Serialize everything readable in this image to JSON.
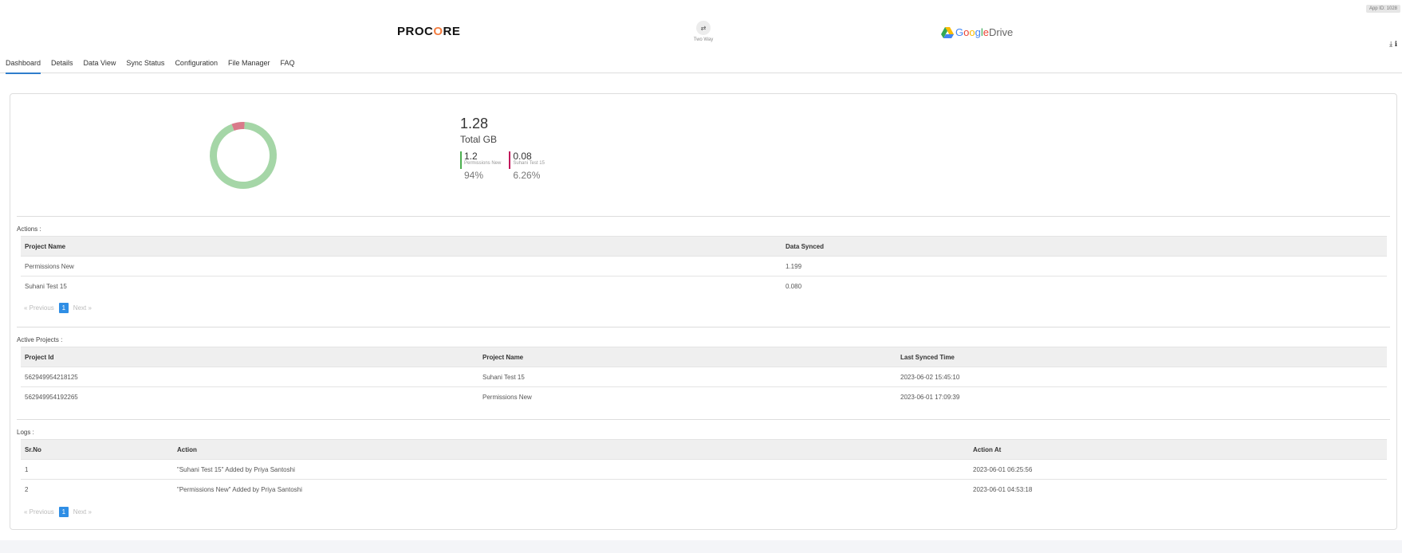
{
  "app_id": "App ID: 1028",
  "header": {
    "procore_logo": "PROCORE",
    "sync_icon": "two-way-arrows-icon",
    "sync_label": "Two Way",
    "gdrive_logo": {
      "google": "Google",
      "drive": "Drive"
    },
    "icons": [
      "download-icon",
      "info-icon"
    ]
  },
  "tabs": [
    {
      "label": "Dashboard",
      "active": true
    },
    {
      "label": "Details"
    },
    {
      "label": "Data View"
    },
    {
      "label": "Sync Status"
    },
    {
      "label": "Configuration"
    },
    {
      "label": "File Manager"
    },
    {
      "label": "FAQ"
    }
  ],
  "summary": {
    "total_value": "1.28",
    "total_label": "Total GB",
    "items": [
      {
        "value": "1.2",
        "name": "Permissions New",
        "percent": "94%",
        "color": "#4caf50"
      },
      {
        "value": "0.08",
        "name": "Suhani Test 15",
        "percent": "6.26%",
        "color": "#c2185b"
      }
    ]
  },
  "chart_data": {
    "type": "pie",
    "categories": [
      "Permissions New",
      "Suhani Test 15"
    ],
    "values": [
      94,
      6.26
    ],
    "colors": [
      "#a5d6a7",
      "#d97a8a"
    ]
  },
  "actions": {
    "title": "Actions :",
    "columns": [
      "Project Name",
      "Data Synced"
    ],
    "rows": [
      [
        "Permissions New",
        "1.199"
      ],
      [
        "Suhani Test 15",
        "0.080"
      ]
    ],
    "pager": {
      "prev": "Previous",
      "page": "1",
      "next": "Next"
    }
  },
  "active_projects": {
    "title": "Active Projects :",
    "columns": [
      "Project Id",
      "Project Name",
      "Last Synced Time"
    ],
    "rows": [
      [
        "562949954218125",
        "Suhani Test 15",
        "2023-06-02 15:45:10"
      ],
      [
        "562949954192265",
        "Permissions New",
        "2023-06-01 17:09:39"
      ]
    ]
  },
  "logs": {
    "title": "Logs :",
    "columns": [
      "Sr.No",
      "Action",
      "Action At"
    ],
    "rows": [
      [
        "1",
        "\"Suhani Test 15\" Added by Priya Santoshi",
        "2023-06-01 06:25:56"
      ],
      [
        "2",
        "\"Permissions New\" Added by Priya Santoshi",
        "2023-06-01 04:53:18"
      ]
    ],
    "pager": {
      "prev": "Previous",
      "page": "1",
      "next": "Next"
    }
  }
}
